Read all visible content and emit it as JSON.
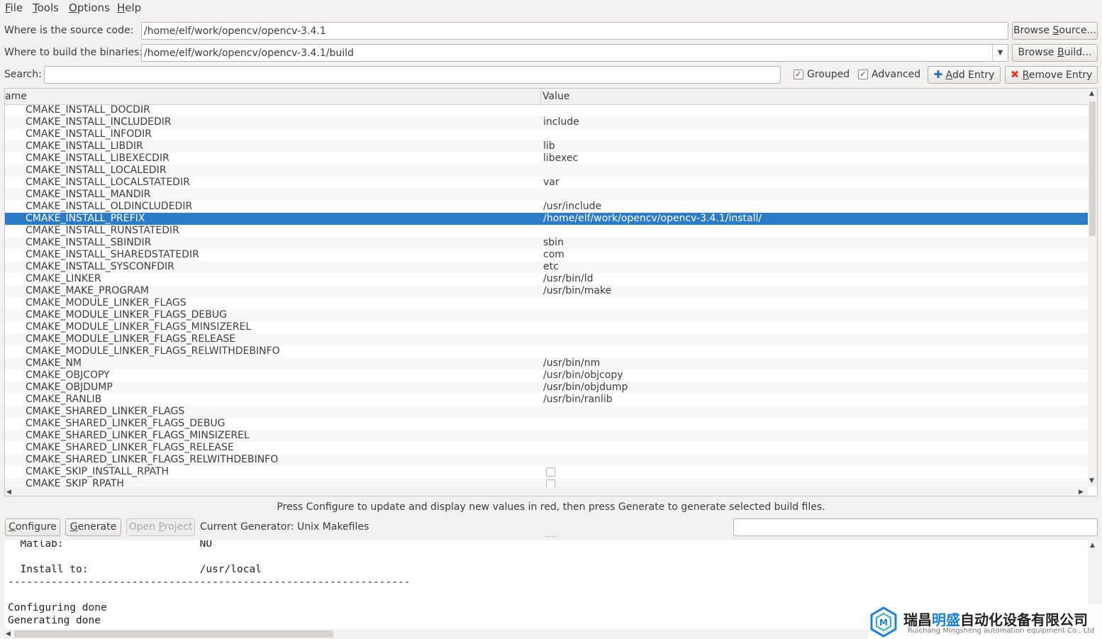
{
  "menu": [
    {
      "label": "File",
      "ul": "F",
      "rest": "ile"
    },
    {
      "label": "Tools",
      "ul": "T",
      "rest": "ools"
    },
    {
      "label": "Options",
      "ul": "O",
      "rest": "ptions"
    },
    {
      "label": "Help",
      "ul": "H",
      "rest": "elp"
    }
  ],
  "source": {
    "label": "Where is the source code:",
    "value": "/home/elf/work/opencv/opencv-3.4.1",
    "browse_pre": "Browse ",
    "browse_ul": "S",
    "browse_post": "ource..."
  },
  "build": {
    "label": "Where to build the binaries:",
    "value": "/home/elf/work/opencv/opencv-3.4.1/build",
    "browse_pre": "Browse ",
    "browse_ul": "B",
    "browse_post": "uild..."
  },
  "search": {
    "label": "Search:",
    "value": ""
  },
  "options": {
    "grouped_label": "Grouped",
    "grouped_checked": true,
    "advanced_label": "Advanced",
    "advanced_checked": true,
    "add_entry_ul": "A",
    "add_entry_rest": "dd Entry",
    "remove_entry_ul": "R",
    "remove_entry_rest": "emove Entry"
  },
  "table": {
    "header_name": "ame",
    "header_value": "Value",
    "rows": [
      {
        "name": "CMAKE_INSTALL_DOCDIR",
        "value": ""
      },
      {
        "name": "CMAKE_INSTALL_INCLUDEDIR",
        "value": "include"
      },
      {
        "name": "CMAKE_INSTALL_INFODIR",
        "value": ""
      },
      {
        "name": "CMAKE_INSTALL_LIBDIR",
        "value": "lib"
      },
      {
        "name": "CMAKE_INSTALL_LIBEXECDIR",
        "value": "libexec"
      },
      {
        "name": "CMAKE_INSTALL_LOCALEDIR",
        "value": ""
      },
      {
        "name": "CMAKE_INSTALL_LOCALSTATEDIR",
        "value": "var"
      },
      {
        "name": "CMAKE_INSTALL_MANDIR",
        "value": ""
      },
      {
        "name": "CMAKE_INSTALL_OLDINCLUDEDIR",
        "value": "/usr/include"
      },
      {
        "name": "CMAKE_INSTALL_PREFIX",
        "value": "/home/elf/work/opencv/opencv-3.4.1/install/",
        "selected": true
      },
      {
        "name": "CMAKE_INSTALL_RUNSTATEDIR",
        "value": ""
      },
      {
        "name": "CMAKE_INSTALL_SBINDIR",
        "value": "sbin"
      },
      {
        "name": "CMAKE_INSTALL_SHAREDSTATEDIR",
        "value": "com"
      },
      {
        "name": "CMAKE_INSTALL_SYSCONFDIR",
        "value": "etc"
      },
      {
        "name": "CMAKE_LINKER",
        "value": "/usr/bin/ld"
      },
      {
        "name": "CMAKE_MAKE_PROGRAM",
        "value": "/usr/bin/make"
      },
      {
        "name": "CMAKE_MODULE_LINKER_FLAGS",
        "value": ""
      },
      {
        "name": "CMAKE_MODULE_LINKER_FLAGS_DEBUG",
        "value": ""
      },
      {
        "name": "CMAKE_MODULE_LINKER_FLAGS_MINSIZEREL",
        "value": ""
      },
      {
        "name": "CMAKE_MODULE_LINKER_FLAGS_RELEASE",
        "value": ""
      },
      {
        "name": "CMAKE_MODULE_LINKER_FLAGS_RELWITHDEBINFO",
        "value": ""
      },
      {
        "name": "CMAKE_NM",
        "value": "/usr/bin/nm"
      },
      {
        "name": "CMAKE_OBJCOPY",
        "value": "/usr/bin/objcopy"
      },
      {
        "name": "CMAKE_OBJDUMP",
        "value": "/usr/bin/objdump"
      },
      {
        "name": "CMAKE_RANLIB",
        "value": "/usr/bin/ranlib"
      },
      {
        "name": "CMAKE_SHARED_LINKER_FLAGS",
        "value": ""
      },
      {
        "name": "CMAKE_SHARED_LINKER_FLAGS_DEBUG",
        "value": ""
      },
      {
        "name": "CMAKE_SHARED_LINKER_FLAGS_MINSIZEREL",
        "value": ""
      },
      {
        "name": "CMAKE_SHARED_LINKER_FLAGS_RELEASE",
        "value": ""
      },
      {
        "name": "CMAKE_SHARED_LINKER_FLAGS_RELWITHDEBINFO",
        "value": ""
      },
      {
        "name": "CMAKE_SKIP_INSTALL_RPATH",
        "value": "",
        "checkbox": true,
        "checked": false
      },
      {
        "name": "CMAKE_SKIP_RPATH",
        "value": "",
        "checkbox": true,
        "checked": false
      }
    ]
  },
  "hint": "Press Configure to update and display new values in red, then press Generate to generate selected build files.",
  "actions": {
    "configure_ul": "C",
    "configure_rest": "onfigure",
    "generate_ul": "G",
    "generate_rest": "enerate",
    "open_project_pre": "Open ",
    "open_project_ul": "P",
    "open_project_post": "roject",
    "current_generator": "Current Generator: Unix Makefiles",
    "filter_value": ""
  },
  "log": "  Matlab:                      NO\n\n  Install to:                  /usr/local\n-----------------------------------------------------------------\n\nConfiguring done\nGenerating done",
  "watermark": {
    "cn_pre": "瑞昌",
    "cn_accent": "明盛",
    "cn_post": "自动化设备有限公司",
    "en": "Ruichang Mingsheng automation equipment Co., Ltd",
    "accent_color": "#1a7fd6",
    "logo_icon": "hexagon-logo-icon"
  },
  "colors": {
    "selection": "#2c7bc6",
    "window_bg": "#f2f1f0",
    "remove_icon": "#e0402a",
    "add_icon": "#2d6fc1"
  }
}
